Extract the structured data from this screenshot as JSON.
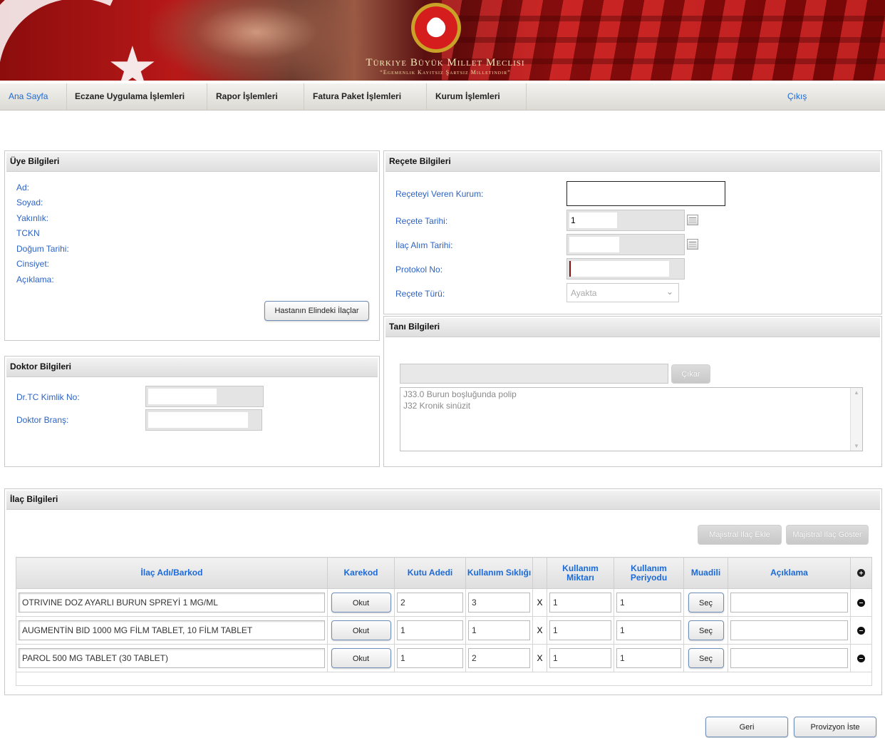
{
  "banner": {
    "title": "Türkiye Büyük Millet Meclisi",
    "subtitle": "“Egemenlik Kayıtsız Şartsız Milletindir”"
  },
  "nav": {
    "items": [
      "Ana Sayfa",
      "Eczane Uygulama İşlemleri",
      "Rapor İşlemleri",
      "Fatura Paket İşlemleri",
      "Kurum İşlemleri"
    ],
    "exit": "Çıkış"
  },
  "uye": {
    "title": "Üye Bilgileri",
    "labels": [
      "Ad:",
      "Soyad:",
      "Yakınlık:",
      "TCKN",
      "Doğum Tarihi:",
      "Cinsiyet:",
      "Açıklama:"
    ],
    "button": "Hastanın Elindeki İlaçlar"
  },
  "doktor": {
    "title": "Doktor Bilgileri",
    "tc_label": "Dr.TC Kimlik No:",
    "brans_label": "Doktor Branş:"
  },
  "recete": {
    "title": "Reçete Bilgileri",
    "kurum_label": "Reçeteyi Veren Kurum:",
    "tarih_label": "Reçete Tarihi:",
    "tarih_value": "1",
    "alim_label": "İlaç Alım Tarihi:",
    "protokol_label": "Protokol No:",
    "tur_label": "Reçete Türü:",
    "tur_value": "Ayakta"
  },
  "tani": {
    "title": "Tanı Bilgileri",
    "cikar": "Çıkar",
    "items": [
      "J33.0 Burun boşluğunda polip",
      "J32 Kronik sinüzit"
    ]
  },
  "ilac": {
    "title": "İlaç Bilgileri",
    "majistral_ekle": "Majistral İlaç Ekle",
    "majistral_goster": "Majistral İlaç Göster",
    "headers": {
      "ad": "İlaç Adı/Barkod",
      "karekod": "Karekod",
      "kutu": "Kutu Adedi",
      "siklik": "Kullanım Sıklığı",
      "miktar": "Kullanım Miktarı",
      "periyod": "Kullanım Periyodu",
      "muadil": "Muadili",
      "aciklama": "Açıklama"
    },
    "okut_label": "Okut",
    "sec_label": "Seç",
    "times": "X",
    "rows": [
      {
        "name": "OTRIVINE DOZ AYARLI BURUN SPREYİ 1 MG/ML",
        "kutu": "2",
        "siklik": "3",
        "miktar": "1",
        "periyod": "1"
      },
      {
        "name": "AUGMENTİN BID 1000 MG FİLM TABLET, 10 FİLM TABLET",
        "kutu": "1",
        "siklik": "1",
        "miktar": "1",
        "periyod": "1"
      },
      {
        "name": "PAROL 500 MG TABLET (30 TABLET)",
        "kutu": "1",
        "siklik": "2",
        "miktar": "1",
        "periyod": "1"
      }
    ]
  },
  "footer": {
    "geri": "Geri",
    "provizyon": "Provizyon İste"
  }
}
